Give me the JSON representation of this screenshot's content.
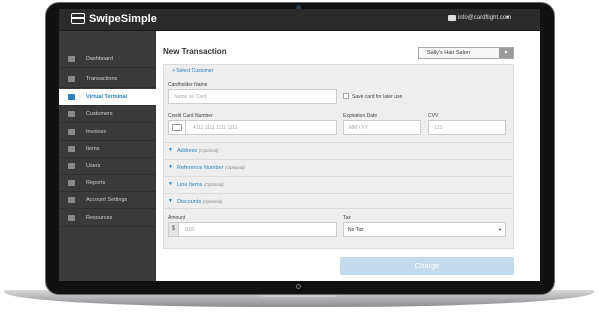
{
  "app": {
    "brand": "SwipeSimple",
    "user_email": "info@cardflight.com",
    "user_caret": "▾"
  },
  "sidebar": {
    "items": [
      {
        "label": "Dashboard",
        "icon": "dashboard-icon",
        "active": false
      },
      {
        "label": "Transactions",
        "icon": "list-icon",
        "active": false
      },
      {
        "label": "Virtual Terminal",
        "icon": "terminal-icon",
        "active": true
      },
      {
        "label": "Customers",
        "icon": "users-icon",
        "active": false
      },
      {
        "label": "Invoices",
        "icon": "invoice-icon",
        "active": false
      },
      {
        "label": "Items",
        "icon": "items-icon",
        "active": false
      },
      {
        "label": "Users",
        "icon": "user-icon",
        "active": false
      },
      {
        "label": "Reports",
        "icon": "reports-icon",
        "active": false
      },
      {
        "label": "Account Settings",
        "icon": "gear-icon",
        "active": false
      },
      {
        "label": "Resources",
        "icon": "resources-icon",
        "active": false
      }
    ]
  },
  "main": {
    "title": "New Transaction",
    "merchant_select": {
      "value": "Sally's Hair Salon",
      "arrow": "▼"
    },
    "select_customer": "+ Select Customer",
    "cardholder": {
      "label": "Cardholder Name",
      "placeholder": "Name on Card"
    },
    "save_card_label": "Save card for later use",
    "card_number": {
      "label": "Credit Card Number",
      "placeholder": "4111 1111 1111 1111"
    },
    "expiration": {
      "label": "Expiration Date",
      "placeholder": "MM / YY"
    },
    "cvv": {
      "label": "CVV",
      "placeholder": "123"
    },
    "sections": [
      {
        "label": "Address",
        "optional": "(Optional)"
      },
      {
        "label": "Reference Number",
        "optional": "(Optional)"
      },
      {
        "label": "Line Items",
        "optional": "(Optional)"
      },
      {
        "label": "Discounts",
        "optional": "(Optional)"
      }
    ],
    "amount": {
      "label": "Amount",
      "currency": "$",
      "placeholder": "0.00"
    },
    "tax": {
      "label": "Tax",
      "value": "No Tax",
      "arrow": "▼"
    },
    "charge_label": "Charge"
  },
  "colors": {
    "accent": "#2a7fc1",
    "sidebar_bg": "#3a3a3a",
    "header_bg": "#2b2b2b",
    "charge_bg": "#c3d9ec"
  }
}
